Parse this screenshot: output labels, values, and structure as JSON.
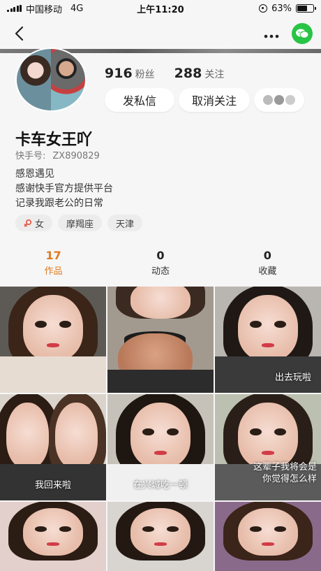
{
  "status_bar": {
    "carrier": "中国移动",
    "network": "4G",
    "time": "上午11:20",
    "battery_percent": "63%",
    "battery_level": 0.63
  },
  "nav": {
    "back_icon": "chevron-left-icon",
    "more_icon": "more-icon",
    "share_icon": "wechat-icon"
  },
  "profile": {
    "followers_count": "916",
    "followers_label": "粉丝",
    "following_count": "288",
    "following_label": "关注",
    "message_button": "发私信",
    "unfollow_button": "取消关注",
    "username": "卡车女王吖",
    "id_label": "快手号:",
    "id_value": "ZX890829",
    "bio": [
      "感恩遇见",
      "感谢快手官方提供平台",
      "记录我跟老公的日常"
    ],
    "tags": [
      "女",
      "摩羯座",
      "天津"
    ]
  },
  "tabs": [
    {
      "count": "17",
      "label": "作品",
      "active": true
    },
    {
      "count": "0",
      "label": "动态",
      "active": false
    },
    {
      "count": "0",
      "label": "收藏",
      "active": false
    }
  ],
  "grid": {
    "captions": [
      "出去玩啦",
      "我回来啦",
      "在兴城吃一顿",
      "这辈子我将会是",
      "你觉得怎么样"
    ]
  },
  "colors": {
    "accent": "#e07a1f",
    "wechat": "#28c445",
    "background": "#f6f6f6"
  }
}
